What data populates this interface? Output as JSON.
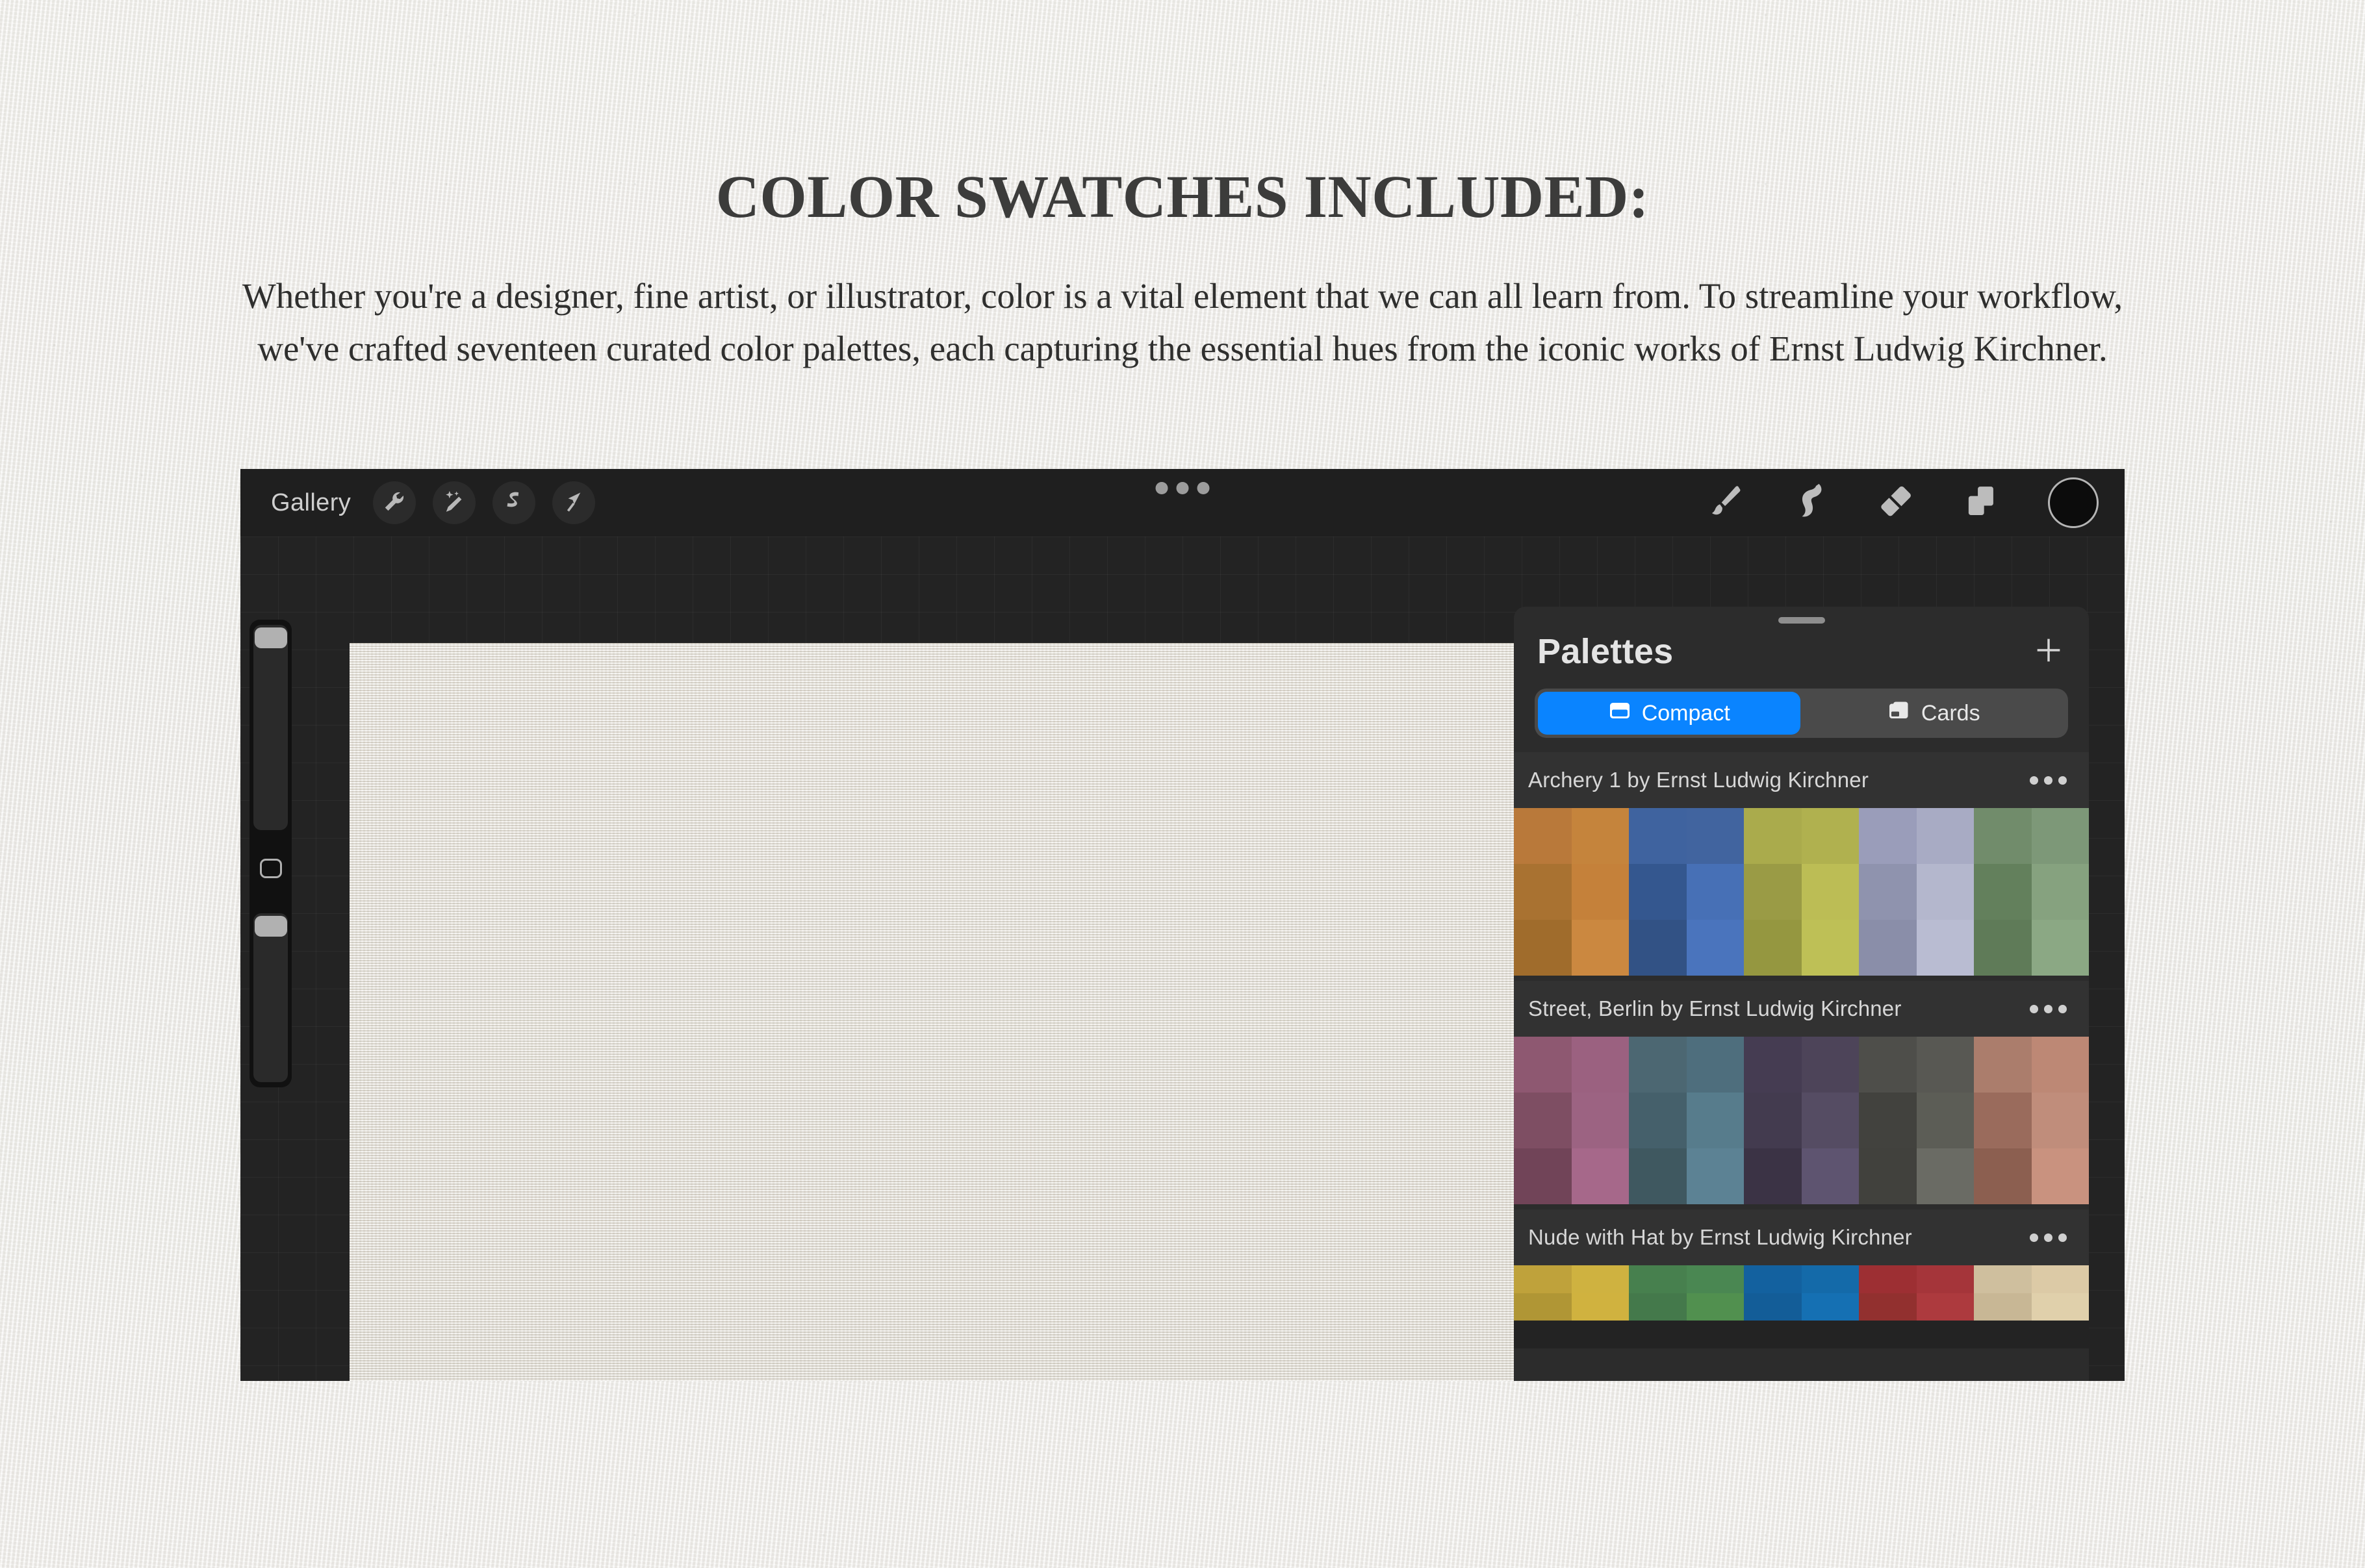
{
  "promo": {
    "heading": "COLOR SWATCHES INCLUDED:",
    "body": "Whether you're a designer, fine artist, or illustrator, color is a vital element that we can all learn from. To streamline your workflow, we've crafted seventeen curated color palettes, each capturing the essential hues from the iconic works of Ernst Ludwig Kirchner."
  },
  "app": {
    "toolbar": {
      "gallery_label": "Gallery",
      "left_tools": [
        {
          "name": "actions-wrench-icon"
        },
        {
          "name": "adjustments-wand-icon"
        },
        {
          "name": "selection-icon"
        },
        {
          "name": "transform-arrow-icon"
        }
      ],
      "overflow_menu": "…",
      "right_tools": [
        {
          "name": "brush-icon"
        },
        {
          "name": "smudge-icon"
        },
        {
          "name": "eraser-icon"
        },
        {
          "name": "layers-icon"
        }
      ],
      "color_well": "#0c0c0c"
    },
    "sidebar": {
      "brush_size_label": "Brush size",
      "brush_opacity_label": "Brush opacity",
      "modify_label": "Modify"
    },
    "canvas": {
      "paper_color": "#dedad2"
    },
    "palettes_panel": {
      "title": "Palettes",
      "add_label": "+",
      "view_modes": [
        {
          "label": "Compact",
          "icon": "compact-view-icon",
          "active": true
        },
        {
          "label": "Cards",
          "icon": "cards-view-icon",
          "active": false
        }
      ],
      "accent_color": "#0a84ff",
      "palettes": [
        {
          "name": "Archery 1 by Ernst Ludwig Kirchner",
          "menu": "…",
          "partial": false,
          "swatches": [
            "#b9793a",
            "#c5843c",
            "#3f639f",
            "#41649f",
            "#aaab4c",
            "#b0b14f",
            "#9a9dba",
            "#a8abc4",
            "#718c6b",
            "#7d9878",
            "#a97231",
            "#c5813a",
            "#34578f",
            "#4770b6",
            "#9a9b45",
            "#bcbd55",
            "#8f93ae",
            "#b4b7cd",
            "#63805c",
            "#86a27f",
            "#a06c2c",
            "#cb8840",
            "#325285",
            "#4a74bd",
            "#959740",
            "#bec056",
            "#8a8ea9",
            "#b9bcd2",
            "#5f7b58",
            "#8ba884"
          ]
        },
        {
          "name": "Street, Berlin by Ernst Ludwig Kirchner",
          "menu": "…",
          "partial": false,
          "swatches": [
            "#8e5871",
            "#9b6180",
            "#4c6772",
            "#4e6e7d",
            "#453c52",
            "#4d4459",
            "#4e4e4a",
            "#585853",
            "#ab7d6c",
            "#bd8875",
            "#7e4e63",
            "#9c6382",
            "#45606b",
            "#577c8c",
            "#433b4f",
            "#554c63",
            "#42423e",
            "#5c5d56",
            "#9a6b5c",
            "#c08d7b",
            "#714458",
            "#a6688a",
            "#3f5860",
            "#5c8294",
            "#3b3345",
            "#5e5470",
            "#41413d",
            "#6a6b64",
            "#8c5f50",
            "#c9927f"
          ]
        },
        {
          "name": "Nude with Hat by Ernst Ludwig Kirchner",
          "menu": "…",
          "partial": true,
          "swatches": [
            "#bfa23b",
            "#cfb240",
            "#47804e",
            "#4a8752",
            "#13619f",
            "#146aa9",
            "#9d2f33",
            "#a5353a",
            "#cfbf9e",
            "#dccaa6",
            "#b09635",
            "#d0b23f",
            "#44794b",
            "#51904f",
            "#135d98",
            "#1570b3",
            "#92302f",
            "#ad3a3e",
            "#c8b795",
            "#e0d0ab"
          ]
        }
      ]
    }
  }
}
